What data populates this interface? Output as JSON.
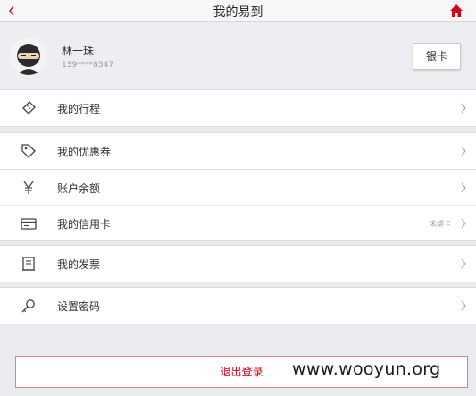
{
  "header": {
    "back_label": "<",
    "title": "我的易到"
  },
  "profile": {
    "name": "林一珠",
    "phone": "139****8547",
    "bind_card_button": "银卡"
  },
  "menu": {
    "trips": "我的行程",
    "coupons": "我的优惠券",
    "balance": "账户余额",
    "credit_card": "我的信用卡",
    "credit_card_status": "未绑卡",
    "invoice": "我的发票",
    "password": "设置密码"
  },
  "logout_label": "退出登录",
  "watermark": "www.wooyun.org",
  "colors": {
    "accent": "#d0021b",
    "background": "#e9ebee"
  }
}
